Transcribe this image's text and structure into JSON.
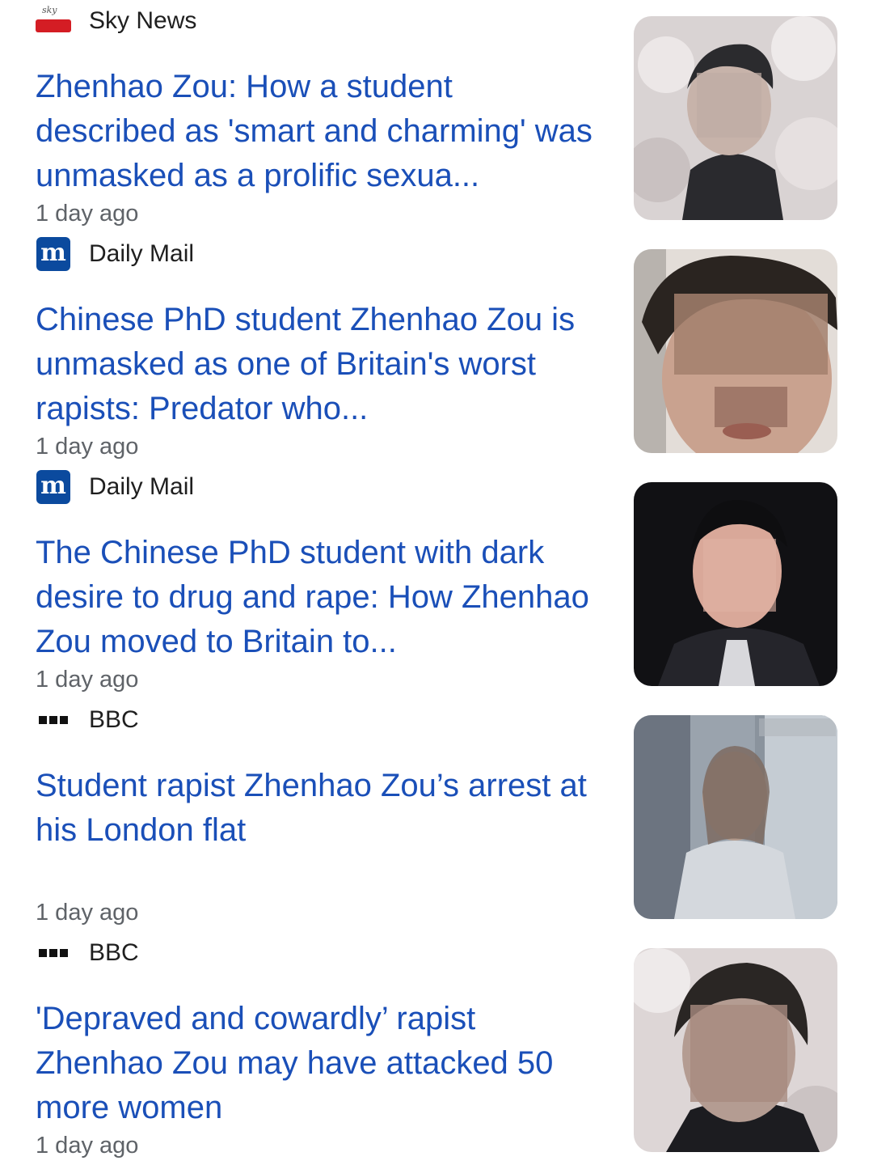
{
  "articles": [
    {
      "source": "Sky News",
      "logo_text": "sky",
      "headline": "Zhenhao Zou: How a student described as 'smart and charming' was unmasked as a prolific sexua...",
      "time": "1 day ago"
    },
    {
      "source": "Daily Mail",
      "logo_text": "m",
      "headline": "Chinese PhD student Zhenhao Zou is unmasked as one of Britain's worst rapists: Predator who...",
      "time": "1 day ago"
    },
    {
      "source": "Daily Mail",
      "logo_text": "m",
      "headline": "The Chinese PhD student with dark desire to drug and rape: How Zhenhao Zou moved to Britain to...",
      "time": "1 day ago"
    },
    {
      "source": "BBC",
      "headline": "Student rapist Zhenhao Zou’s arrest at his London flat",
      "time": "1 day ago"
    },
    {
      "source": "BBC",
      "headline": "'Depraved and cowardly’ rapist Zhenhao Zou may have attacked 50 more women",
      "time": "1 day ago"
    }
  ],
  "colors": {
    "headline": "#1a4fb8",
    "source": "#1f1f1f",
    "timestamp": "#5f6368",
    "sky_red": "#d41d24",
    "mail_blue": "#0b4a9e"
  }
}
